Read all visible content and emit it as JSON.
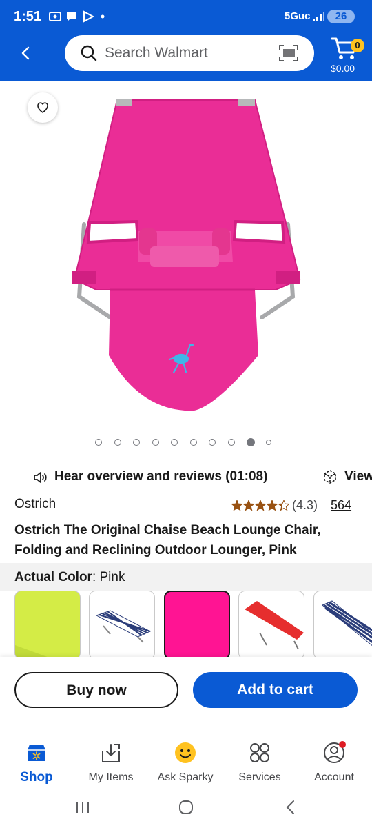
{
  "status_bar": {
    "time": "1:51",
    "network": "5Guc",
    "battery": "26"
  },
  "header": {
    "search_placeholder": "Search Walmart",
    "cart_count": "0",
    "cart_total": "$0.00"
  },
  "gallery": {
    "total_dots": 10,
    "active_index": 8
  },
  "audio": {
    "label": "Hear overview and reviews (01:08)",
    "view_label": "View"
  },
  "product": {
    "brand": "Ostrich",
    "rating": "(4.3)",
    "rating_value": 4.3,
    "review_count": "564",
    "title": "Ostrich The Original Chaise Beach Lounge Chair, Folding and Reclining Outdoor Lounger, Pink"
  },
  "color": {
    "label": "Actual Color",
    "value": ": Pink"
  },
  "swatches": [
    {
      "name": "lime",
      "selected": false
    },
    {
      "name": "blue-white-stripe",
      "selected": false
    },
    {
      "name": "pink",
      "selected": true
    },
    {
      "name": "red",
      "selected": false
    },
    {
      "name": "navy-stripe",
      "selected": false
    }
  ],
  "actions": {
    "buy_now": "Buy now",
    "add_to_cart": "Add to cart"
  },
  "bottom_nav": {
    "shop": "Shop",
    "my_items": "My Items",
    "ask_sparky": "Ask Sparky",
    "services": "Services",
    "account": "Account"
  },
  "colors": {
    "brand_blue": "#0a5ad4",
    "spark_yellow": "#ffc220",
    "product_pink": "#ea2d96"
  }
}
